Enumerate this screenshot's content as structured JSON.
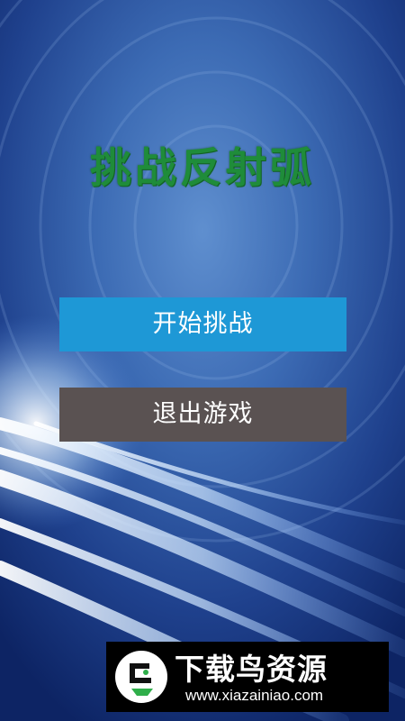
{
  "title": "挑战反射弧",
  "buttons": {
    "start_label": "开始挑战",
    "exit_label": "退出游戏"
  },
  "colors": {
    "title": "#1f8c3a",
    "start_button": "#1e98d6",
    "exit_button": "#5a5252",
    "background": "#16347a"
  },
  "watermark": {
    "name": "下载鸟资源",
    "url": "www.xiazainiao.com",
    "logo_icon": "bird-logo-icon"
  }
}
